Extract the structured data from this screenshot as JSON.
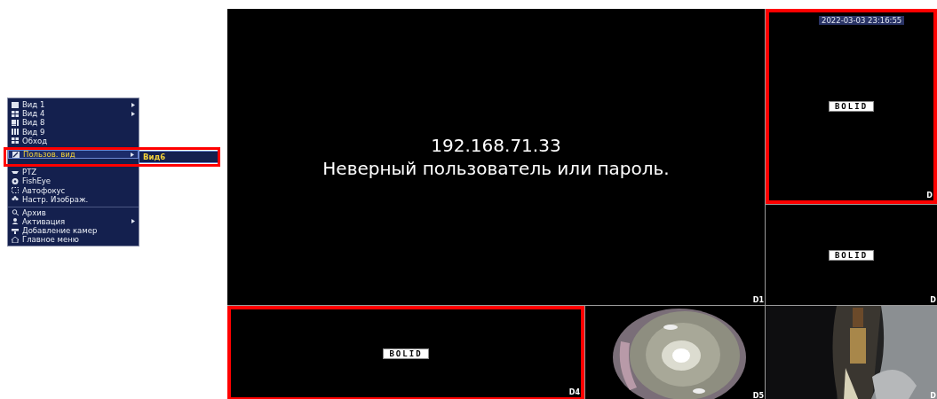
{
  "menu": {
    "items": [
      {
        "label": "Вид 1",
        "submenu": true,
        "selected": false,
        "divider_before": false
      },
      {
        "label": "Вид 4",
        "submenu": true,
        "selected": false,
        "divider_before": false
      },
      {
        "label": "Вид 8",
        "submenu": false,
        "selected": false,
        "divider_before": false
      },
      {
        "label": "Вид 9",
        "submenu": false,
        "selected": false,
        "divider_before": false
      },
      {
        "label": "Обход",
        "submenu": false,
        "selected": false,
        "divider_before": false
      },
      {
        "label": "Пользов. вид",
        "submenu": true,
        "selected": true,
        "divider_before": false
      },
      {
        "label": "PTZ",
        "submenu": false,
        "selected": false,
        "divider_before": false
      },
      {
        "label": "FishEye",
        "submenu": false,
        "selected": false,
        "divider_before": false
      },
      {
        "label": "Автофокус",
        "submenu": false,
        "selected": false,
        "divider_before": false
      },
      {
        "label": "Настр. Изображ.",
        "submenu": false,
        "selected": false,
        "divider_before": false
      },
      {
        "label": "Архив",
        "submenu": false,
        "selected": false,
        "divider_before": true
      },
      {
        "label": "Активация",
        "submenu": true,
        "selected": false,
        "divider_before": false
      },
      {
        "label": "Добавление камер",
        "submenu": false,
        "selected": false,
        "divider_before": false
      },
      {
        "label": "Главное меню",
        "submenu": false,
        "selected": false,
        "divider_before": false
      }
    ],
    "submenu": [
      {
        "label": "Вид6",
        "selected": true
      }
    ]
  },
  "cameras": [
    {
      "label": "D1",
      "kind": "message",
      "lines": [
        "192.168.71.33",
        "Неверный пользователь или пароль."
      ],
      "highlighted": false
    },
    {
      "label": "D",
      "kind": "logo",
      "logo": "BOLID",
      "timestamp": "2022-03-03 23:16:55",
      "highlighted": true
    },
    {
      "label": "D",
      "kind": "logo",
      "logo": "BOLID",
      "highlighted": false
    },
    {
      "label": "D4",
      "kind": "logo",
      "logo": "BOLID",
      "highlighted": true
    },
    {
      "label": "D5",
      "kind": "fisheye",
      "highlighted": false
    },
    {
      "label": "D",
      "kind": "room",
      "highlighted": false
    }
  ]
}
